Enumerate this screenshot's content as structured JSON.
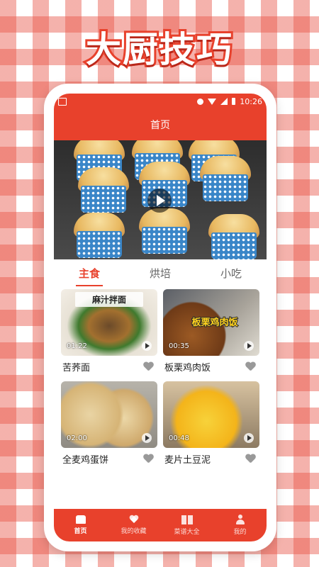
{
  "promo": {
    "title": "大厨技巧"
  },
  "statusbar": {
    "time": "10:26"
  },
  "header": {
    "title": "首页"
  },
  "tabs": [
    {
      "label": "主食",
      "active": true
    },
    {
      "label": "烘培",
      "active": false
    },
    {
      "label": "小吃",
      "active": false
    }
  ],
  "recipes": [
    {
      "title": "苦荞面",
      "duration": "01:22",
      "caption": "麻汁拌面",
      "banner": ""
    },
    {
      "title": "板栗鸡肉饭",
      "duration": "00:35",
      "caption": "",
      "banner": "板栗鸡肉饭"
    },
    {
      "title": "全麦鸡蛋饼",
      "duration": "02:00",
      "caption": "",
      "banner": ""
    },
    {
      "title": "麦片土豆泥",
      "duration": "00:48",
      "caption": "",
      "banner": ""
    }
  ],
  "bottomnav": [
    {
      "label": "首页",
      "icon": "home-icon",
      "active": true
    },
    {
      "label": "我的收藏",
      "icon": "heart-icon",
      "active": false
    },
    {
      "label": "菜谱大全",
      "icon": "book-icon",
      "active": false
    },
    {
      "label": "我的",
      "icon": "user-icon",
      "active": false
    }
  ],
  "colors": {
    "accent": "#e8412c"
  }
}
